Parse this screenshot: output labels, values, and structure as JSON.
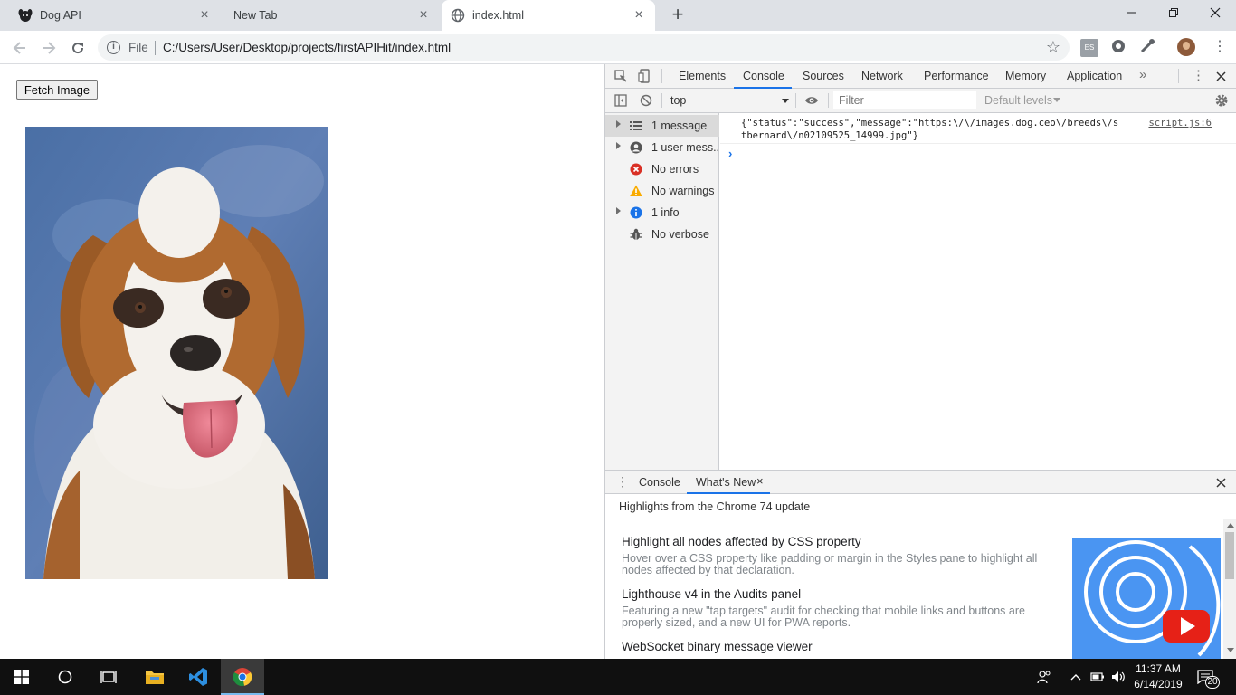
{
  "browser": {
    "tabs": [
      {
        "title": "Dog API"
      },
      {
        "title": "New Tab"
      },
      {
        "title": "index.html"
      }
    ],
    "omnibox": {
      "scheme_label": "File",
      "url": "C:/Users/User/Desktop/projects/firstAPIHit/index.html"
    }
  },
  "page": {
    "fetch_button_label": "Fetch Image",
    "image_subject": "St. Bernard dog photo"
  },
  "devtools": {
    "tabs": [
      "Elements",
      "Console",
      "Sources",
      "Network",
      "Performance",
      "Memory",
      "Application"
    ],
    "active_tab": "Console",
    "context": "top",
    "filter_placeholder": "Filter",
    "levels_label": "Default levels",
    "sidebar": [
      {
        "label": "1 message",
        "icon": "list-icon",
        "expandable": true,
        "selected": true
      },
      {
        "label": "1 user mess...",
        "icon": "user-icon",
        "expandable": true
      },
      {
        "label": "No errors",
        "icon": "error-icon",
        "expandable": false
      },
      {
        "label": "No warnings",
        "icon": "warning-icon",
        "expandable": false
      },
      {
        "label": "1 info",
        "icon": "info-icon",
        "expandable": true
      },
      {
        "label": "No verbose",
        "icon": "bug-icon",
        "expandable": false
      }
    ],
    "console": {
      "log_line1": "{\"status\":\"success\",\"message\":\"https:\\/\\/images.dog.ceo\\/breeds\\/s",
      "log_line2": "tbernard\\/n02109525_14999.jpg\"}",
      "source": "script.js:6"
    },
    "drawer": {
      "tabs": [
        "Console",
        "What's New"
      ],
      "active_tab": "What's New",
      "subtitle": "Highlights from the Chrome 74 update",
      "items": [
        {
          "title": "Highlight all nodes affected by CSS property",
          "desc": "Hover over a CSS property like padding or margin in the Styles pane to highlight all nodes affected by that declaration."
        },
        {
          "title": "Lighthouse v4 in the Audits panel",
          "desc": "Featuring a new \"tap targets\" audit for checking that mobile links and buttons are properly sized, and a new UI for PWA reports."
        },
        {
          "title": "WebSocket binary message viewer",
          "desc": ""
        }
      ]
    }
  },
  "taskbar": {
    "time": "11:37 AM",
    "date": "6/14/2019",
    "notification_count": "20",
    "ext_badge": "ES"
  },
  "colors": {
    "chrome_accent": "#1a73e8",
    "tabstrip_bg": "#dee1e6",
    "taskbar_bg": "#101010",
    "error": "#d93025",
    "warning": "#f9ab00",
    "info": "#1a73e8"
  }
}
